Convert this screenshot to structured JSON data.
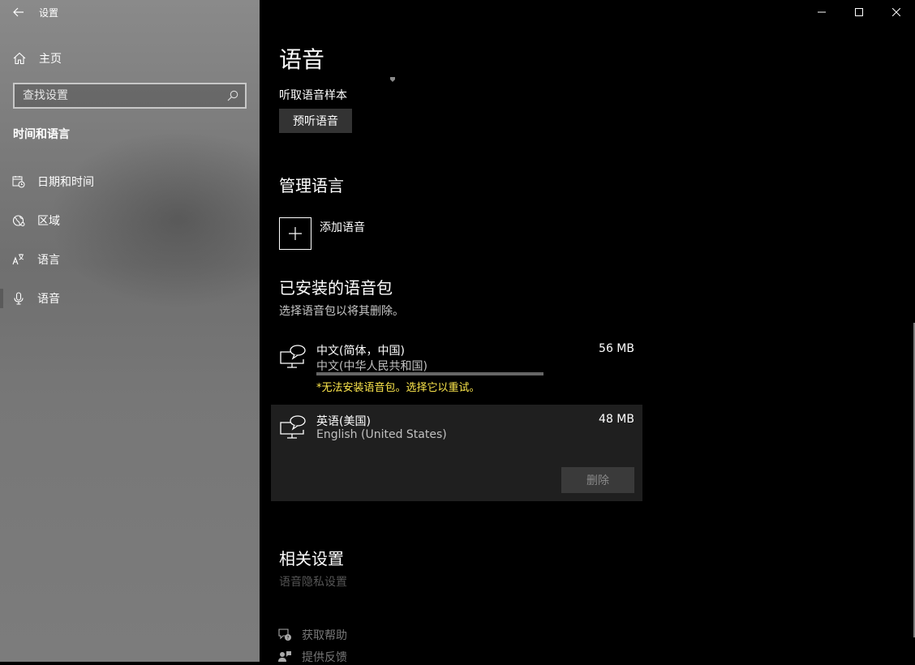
{
  "window": {
    "app_title": "设置"
  },
  "sidebar": {
    "home_label": "主页",
    "search_placeholder": "查找设置",
    "section_title": "时间和语言",
    "items": [
      {
        "label": "日期和时间",
        "icon": "calendar-clock-icon"
      },
      {
        "label": "区域",
        "icon": "globe-icon"
      },
      {
        "label": "语言",
        "icon": "language-icon"
      },
      {
        "label": "语音",
        "icon": "microphone-icon",
        "selected": true
      }
    ]
  },
  "main": {
    "page_title": "语音",
    "sample_label": "听取语音样本",
    "preview_button": "预听语音",
    "manage_title": "管理语言",
    "add_language_label": "添加语音",
    "installed_title": "已安装的语音包",
    "installed_hint": "选择语音包以将其删除。",
    "packs": [
      {
        "name": "中文(简体，中国)",
        "subtitle": "中文(中华人民共和国)",
        "size": "56 MB",
        "error": "*无法安装语音包。选择它以重试。",
        "progress": 1.0
      },
      {
        "name": "英语(美国)",
        "subtitle": "English (United States)",
        "size": "48 MB",
        "remove_label": "删除",
        "selected": true
      }
    ],
    "related_title": "相关设置",
    "related_link": "语音隐私设置",
    "help_items": [
      {
        "label": "获取帮助",
        "icon": "help-chat-icon"
      },
      {
        "label": "提供反馈",
        "icon": "feedback-icon"
      }
    ]
  },
  "colors": {
    "error_text": "#ffe94d",
    "selected_pack_bg": "#1f1f1f",
    "button_bg": "#333333"
  }
}
